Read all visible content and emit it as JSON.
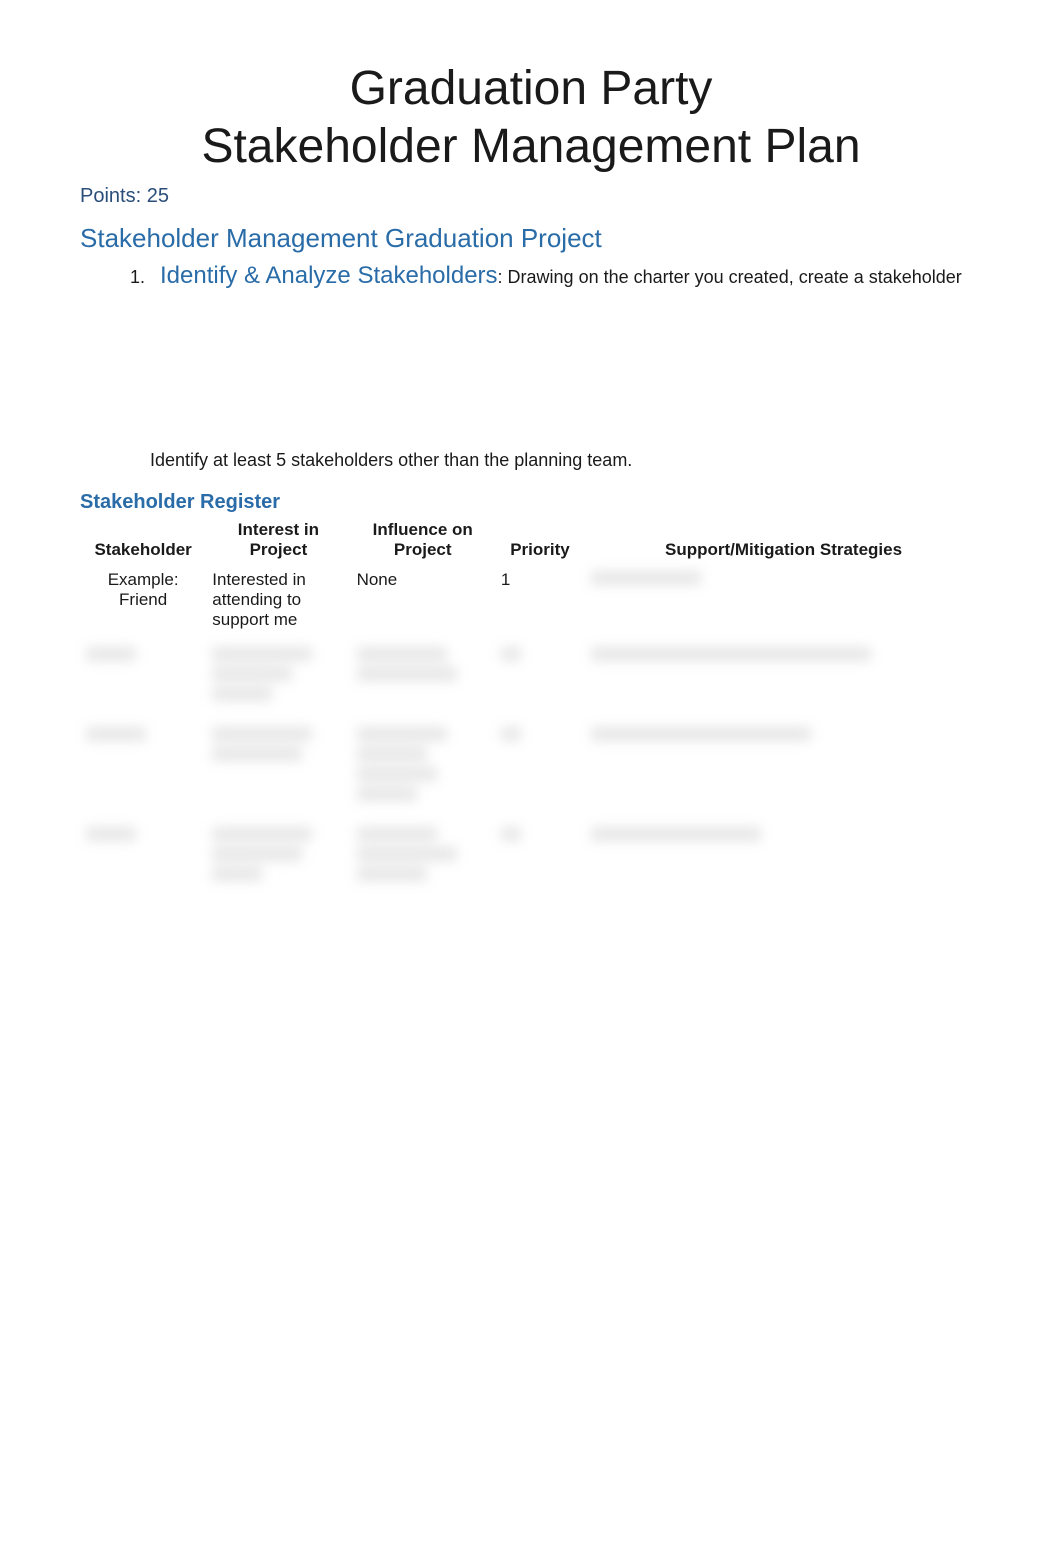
{
  "title_line1": "Graduation Party",
  "title_line2": "Stakeholder Management Plan",
  "points_label": "Points: 25",
  "section_heading": "Stakeholder Management Graduation Project",
  "step": {
    "marker": "1.",
    "title": "Identify & Analyze Stakeholders",
    "desc": ": Drawing on the charter you created, create a stakeholder"
  },
  "sub_instruction": "Identify at least 5 stakeholders other than the planning team.",
  "register_heading": "Stakeholder Register",
  "table": {
    "headers": {
      "stakeholder": "Stakeholder",
      "interest": "Interest in Project",
      "influence": "Influence on Project",
      "priority": "Priority",
      "strategy": "Support/Mitigation Strategies"
    },
    "rows": [
      {
        "stakeholder": "Example: Friend",
        "interest": "Interested in attending to support me",
        "influence": "None",
        "priority": "1",
        "strategy": ""
      }
    ]
  }
}
